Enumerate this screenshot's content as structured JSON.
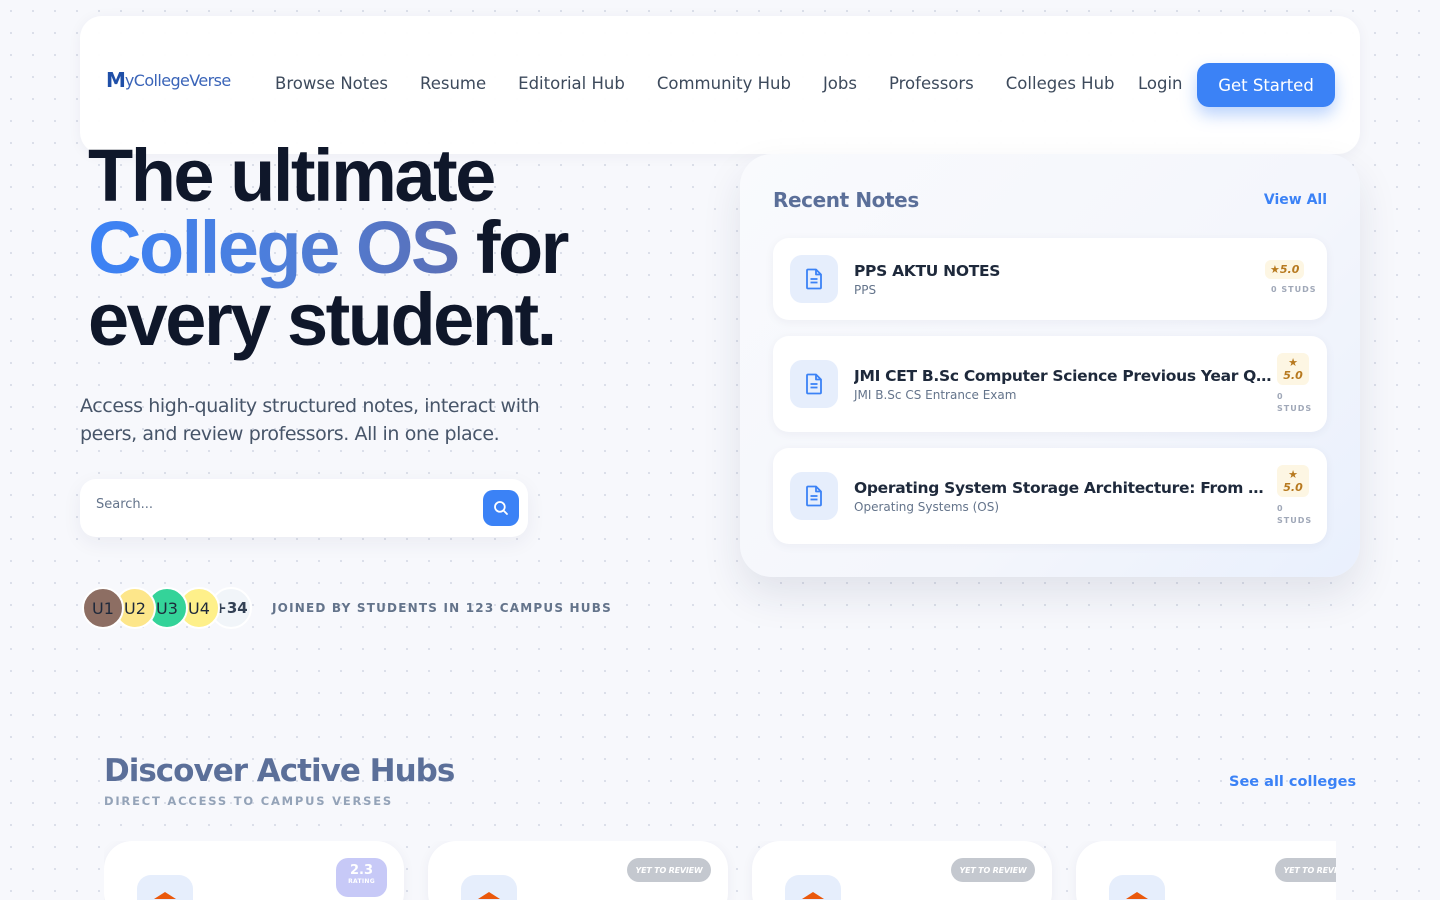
{
  "brand": {
    "logo_mark": "M",
    "logo_text": "yCollegeVerse"
  },
  "nav": {
    "links": [
      "Browse Notes",
      "Resume",
      "Editorial Hub",
      "Community Hub",
      "Jobs",
      "Professors",
      "Colleges Hub"
    ],
    "login": "Login",
    "cta": "Get Started"
  },
  "hero": {
    "title_line1": "The ultimate",
    "title_accent": "College OS",
    "title_line2_rest": " for",
    "title_line3": "every student.",
    "subtitle": "Access high-quality structured notes, interact with peers, and review professors. All in one place.",
    "search_placeholder": "Search...",
    "avatars": [
      {
        "label": "U1",
        "color": "#8d6e63"
      },
      {
        "label": "U2",
        "color": "#fde68a"
      },
      {
        "label": "U3",
        "color": "#34d399"
      },
      {
        "label": "U4",
        "color": "#fef08a"
      },
      {
        "label": "+34",
        "color": "#f1f5f9"
      }
    ],
    "joined_text": "JOINED BY STUDENTS IN 123 CAMPUS HUBS"
  },
  "recent_notes": {
    "title": "Recent Notes",
    "view_all": "View All",
    "items": [
      {
        "title": "PPS AKTU NOTES",
        "subject": "PPS",
        "rating": "5.0",
        "studs_count": "0",
        "studs_label": "STUDS"
      },
      {
        "title": "JMI CET B.Sc Computer Science Previous Year Questions",
        "subject": "JMI B.Sc CS Entrance Exam",
        "rating": "5.0",
        "studs_count": "0",
        "studs_label": "STUDS"
      },
      {
        "title": "Operating System Storage Architecture: From Physical Disks to File Systems",
        "subject": "Operating Systems (OS)",
        "rating": "5.0",
        "studs_count": "0",
        "studs_label": "STUDS"
      }
    ]
  },
  "discover": {
    "title": "Discover Active Hubs",
    "subtitle": "DIRECT ACCESS TO CAMPUS VERSES",
    "see_all": "See all colleges",
    "hubs": [
      {
        "badge_type": "rating",
        "rating": "2.3",
        "rating_label": "RATING"
      },
      {
        "badge_type": "unreviewed",
        "badge_text": "YET TO REVIEW"
      },
      {
        "badge_type": "unreviewed",
        "badge_text": "YET TO REVIEW"
      },
      {
        "badge_type": "unreviewed",
        "badge_text": "YET TO REVIEW"
      }
    ]
  },
  "colors": {
    "accent": "#3b82f6",
    "heading_muted": "#5b6f99",
    "text_dark": "#0f172a"
  }
}
